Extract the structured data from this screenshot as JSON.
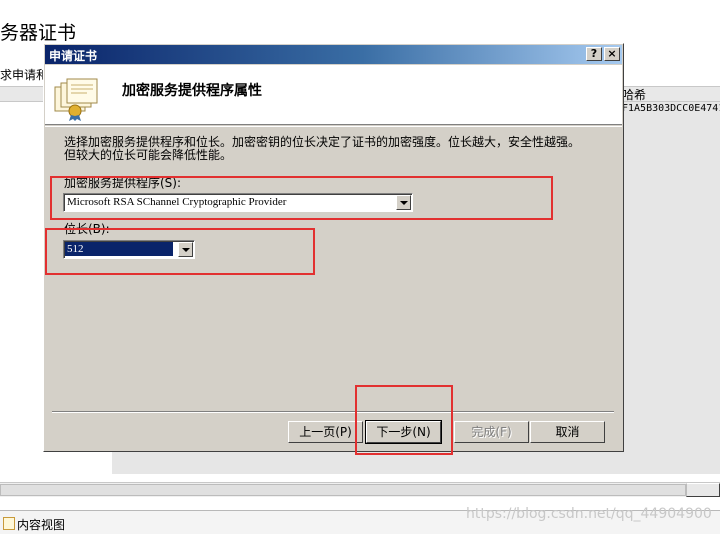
{
  "background": {
    "heading": "务器证书",
    "subtext": "求申请和",
    "column_header": "哈希",
    "hash_value": "F1A5B303DCC0E4741",
    "status_text": "内容视图"
  },
  "watermark": "https://blog.csdn.net/qq_44904900",
  "dialog": {
    "title": "申请证书",
    "help_button": "?",
    "close_button": "×",
    "header_title": "加密服务提供程序属性",
    "description": "选择加密服务提供程序和位长。加密密钥的位长决定了证书的加密强度。位长越大，安全性越强。但较大的位长可能会降低性能。",
    "csp_label": "加密服务提供程序(S):",
    "csp_value": "Microsoft RSA SChannel Cryptographic Provider",
    "bit_label": "位长(B):",
    "bit_value": "512",
    "buttons": {
      "back": "上一页(P)",
      "next": "下一步(N)",
      "finish": "完成(F)",
      "cancel": "取消"
    }
  },
  "colors": {
    "title_bar_start": "#0a246a",
    "title_bar_end": "#a6caf0",
    "dialog_face": "#d4d0c8",
    "selection": "#0a246a",
    "annotation": "#e23030"
  }
}
